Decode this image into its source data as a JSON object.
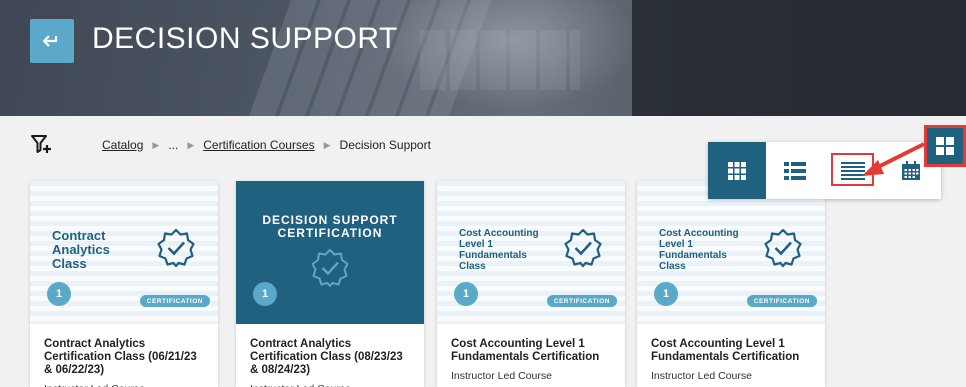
{
  "header": {
    "title": "DECISION SUPPORT",
    "back_icon": "back-arrow-icon"
  },
  "breadcrumb": {
    "filter_icon": "filter-plus-icon",
    "items": [
      "Catalog",
      "...",
      "Certification Courses",
      "Decision Support"
    ]
  },
  "view_switcher": {
    "options": [
      "tile-view",
      "list-view",
      "detailed-list-view",
      "calendar-view"
    ],
    "active": "tile-view",
    "highlighted": "detailed-list-view",
    "toggle_icon": "grid-layout-icon"
  },
  "cards": [
    {
      "thumb_text": [
        "Contract",
        "Analytics",
        "Class"
      ],
      "count": "1",
      "pill": "CERTIFICATION",
      "title": "Contract Analytics Certification Class (06/21/23 & 06/22/23)",
      "type": "Instructor Led Course"
    },
    {
      "thumb_title": [
        "DECISION SUPPORT",
        "CERTIFICATION"
      ],
      "count": "1",
      "title": "Contract Analytics Certification Class (08/23/23 & 08/24/23)",
      "type": "Instructor Led Course"
    },
    {
      "thumb_text": [
        "Cost Accounting",
        "Level 1",
        "Fundamentals",
        "Class"
      ],
      "count": "1",
      "pill": "CERTIFICATION",
      "title": "Cost Accounting Level 1 Fundamentals Certification",
      "type": "Instructor Led Course"
    },
    {
      "thumb_text": [
        "Cost Accounting",
        "Level 1",
        "Fundamentals",
        "Class"
      ],
      "count": "1",
      "pill": "CERTIFICATION",
      "title": "Cost Accounting Level 1 Fundamentals Certification",
      "type": "Instructor Led Course"
    }
  ],
  "colors": {
    "primary_dark": "#1f617e",
    "accent": "#5aa9c9",
    "highlight": "#e53935"
  }
}
